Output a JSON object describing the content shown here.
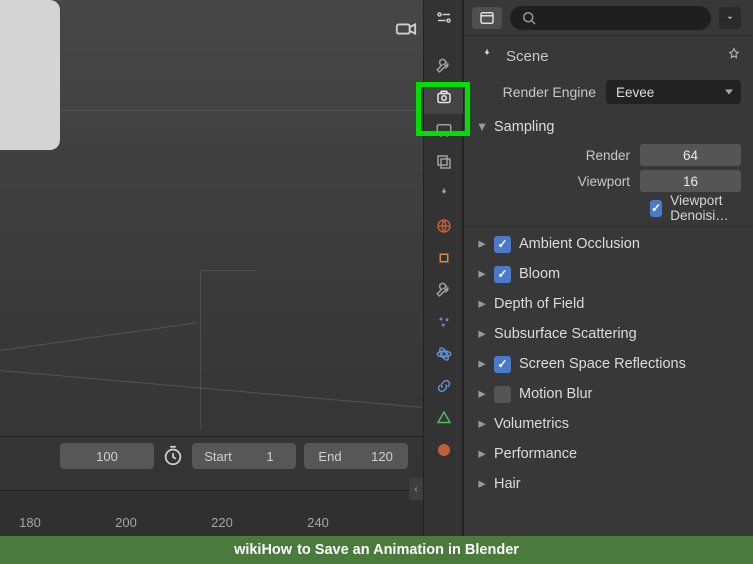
{
  "viewport": {
    "camera_icon": "camera-icon"
  },
  "timeline": {
    "current_frame": "100",
    "start_label": "Start",
    "start_value": "1",
    "end_label": "End",
    "end_value": "120",
    "ticks": [
      "180",
      "200",
      "220",
      "240"
    ]
  },
  "panel_header": {
    "editor_type": "properties-editor",
    "search_placeholder": ""
  },
  "scene": {
    "label": "Scene"
  },
  "render": {
    "engine_label": "Render Engine",
    "engine_value": "Eevee",
    "sampling_label": "Sampling",
    "render_label": "Render",
    "render_value": "64",
    "viewport_label": "Viewport",
    "viewport_value": "16",
    "denoise_label": "Viewport Denoisi…"
  },
  "sections": {
    "ao": {
      "label": "Ambient Occlusion",
      "checked": true
    },
    "bloom": {
      "label": "Bloom",
      "checked": true
    },
    "dof": {
      "label": "Depth of Field",
      "checked": null
    },
    "sss": {
      "label": "Subsurface Scattering",
      "checked": null
    },
    "ssr": {
      "label": "Screen Space Reflections",
      "checked": true
    },
    "mblur": {
      "label": "Motion Blur",
      "checked": false
    },
    "vol": {
      "label": "Volumetrics",
      "checked": null
    },
    "perf": {
      "label": "Performance",
      "checked": null
    },
    "hair": {
      "label": "Hair",
      "checked": null
    }
  },
  "caption": {
    "brand": "wikiHow",
    "text": " to Save an Animation in Blender"
  }
}
